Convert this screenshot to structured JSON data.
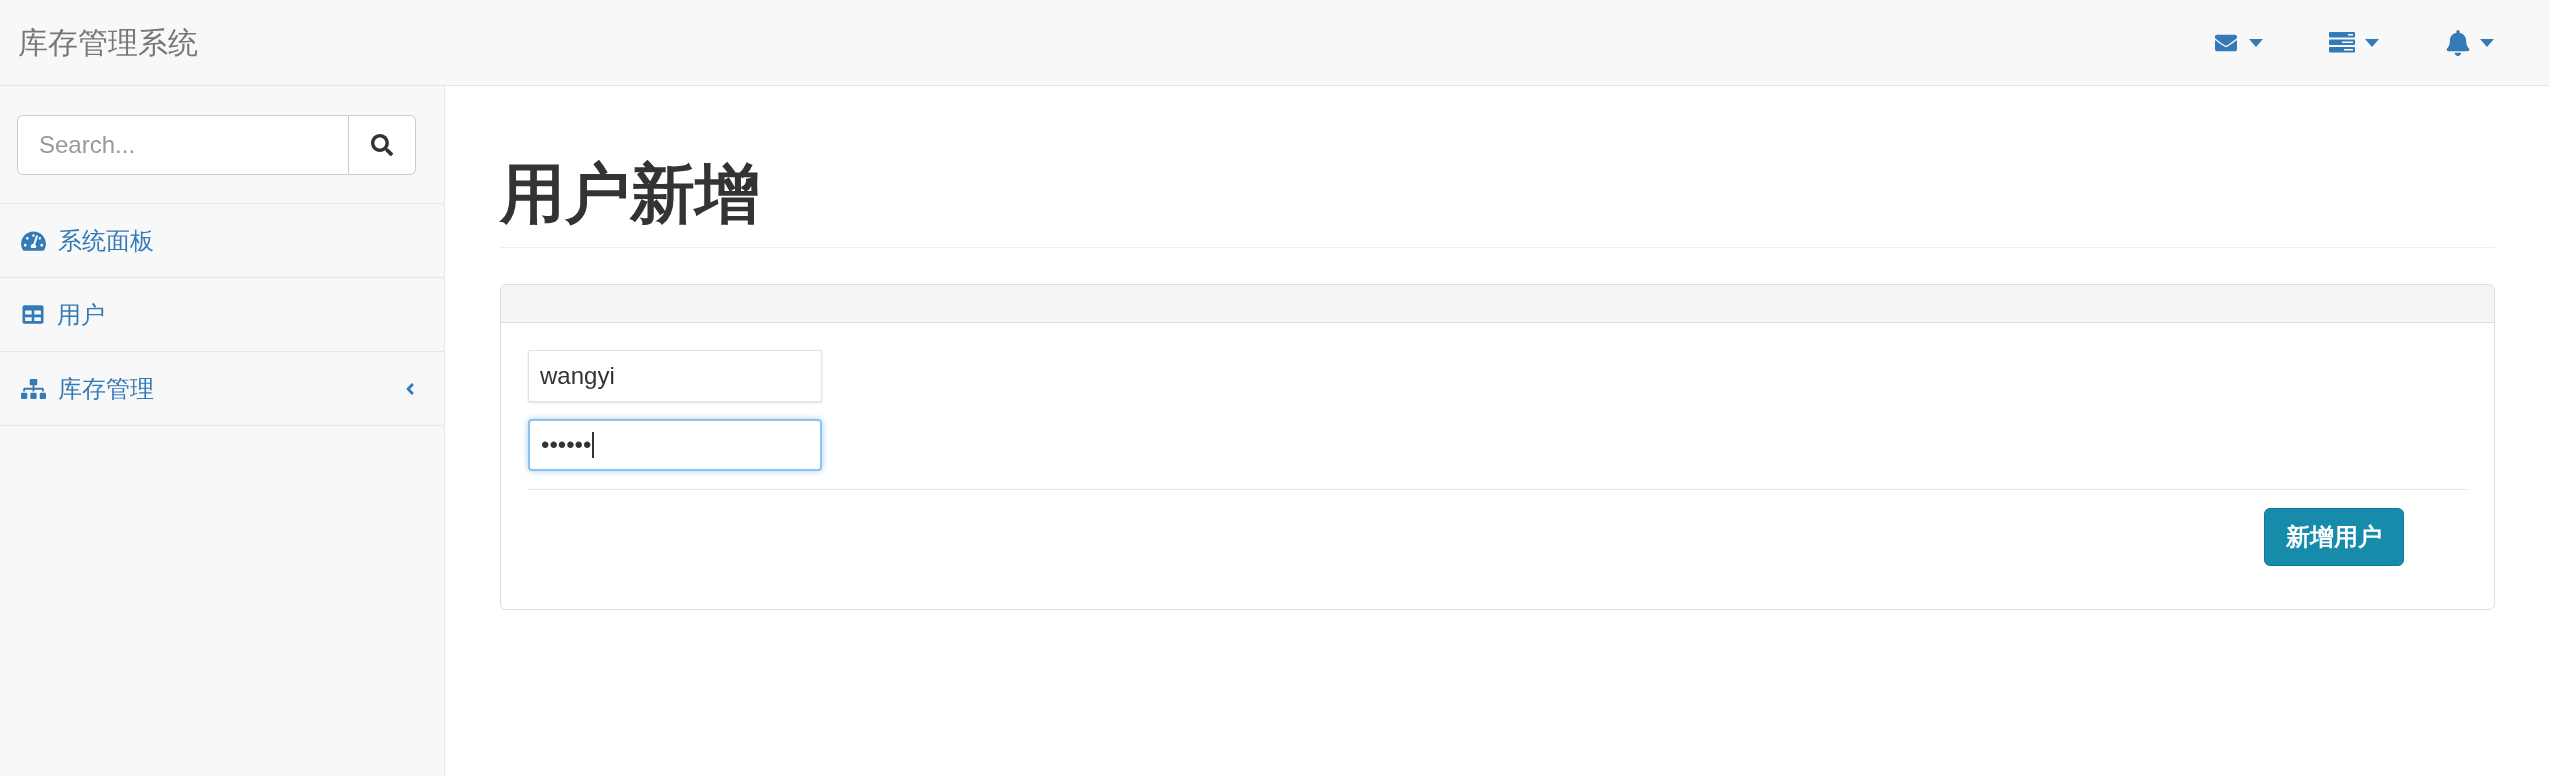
{
  "navbar": {
    "brand": "库存管理系统"
  },
  "sidebar": {
    "search": {
      "placeholder": "Search..."
    },
    "items": [
      {
        "kind": "link",
        "label": "系统面板"
      },
      {
        "kind": "link",
        "label": "用户"
      },
      {
        "kind": "submenu",
        "label": "库存管理",
        "expanded": false
      }
    ]
  },
  "page": {
    "title": "用户新增",
    "panel": {
      "fields": [
        {
          "value": "wangyi",
          "focused": false
        },
        {
          "value": "••••••",
          "focused": true
        }
      ],
      "submit": "新增用户"
    }
  }
}
